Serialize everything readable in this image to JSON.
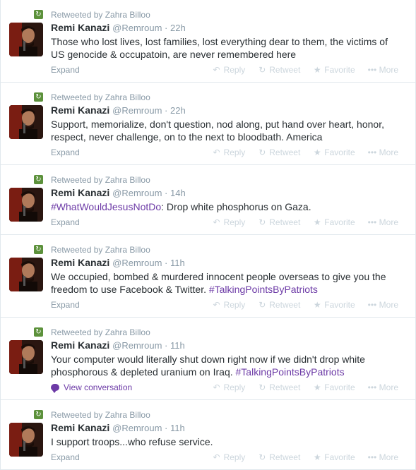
{
  "tweets": [
    {
      "retweeted_by": "Retweeted by Zahra Billoo",
      "fullname": "Remi Kanazi",
      "username": "@Remroum",
      "time": "22h",
      "text_parts": [
        {
          "t": "Those who lost lives, lost families, lost everything dear to them, the victims of US genocide & occupatoin, are never remembered here",
          "tag": false
        }
      ],
      "footer_link": "Expand",
      "footer_type": "expand"
    },
    {
      "retweeted_by": "Retweeted by Zahra Billoo",
      "fullname": "Remi Kanazi",
      "username": "@Remroum",
      "time": "22h",
      "text_parts": [
        {
          "t": "Support, memorialize, don't question, nod along, put hand over heart, honor, respect, never challenge, on to the next to bloodbath. America",
          "tag": false
        }
      ],
      "footer_link": "Expand",
      "footer_type": "expand"
    },
    {
      "retweeted_by": "Retweeted by Zahra Billoo",
      "fullname": "Remi Kanazi",
      "username": "@Remroum",
      "time": "14h",
      "text_parts": [
        {
          "t": "#WhatWouldJesusNotDo",
          "tag": true
        },
        {
          "t": ": Drop white phosphorus on Gaza.",
          "tag": false
        }
      ],
      "footer_link": "Expand",
      "footer_type": "expand"
    },
    {
      "retweeted_by": "Retweeted by Zahra Billoo",
      "fullname": "Remi Kanazi",
      "username": "@Remroum",
      "time": "11h",
      "text_parts": [
        {
          "t": "We occupied, bombed & murdered innocent people overseas to give you the freedom to use Facebook & Twitter. ",
          "tag": false
        },
        {
          "t": "#TalkingPointsByPatriots",
          "tag": true
        }
      ],
      "footer_link": "Expand",
      "footer_type": "expand"
    },
    {
      "retweeted_by": "Retweeted by Zahra Billoo",
      "fullname": "Remi Kanazi",
      "username": "@Remroum",
      "time": "11h",
      "text_parts": [
        {
          "t": "Your computer would literally shut down right now if we didn't drop white phosphorous & depleted uranium on Iraq. ",
          "tag": false
        },
        {
          "t": "#TalkingPointsByPatriots",
          "tag": true
        }
      ],
      "footer_link": "View conversation",
      "footer_type": "conversation"
    },
    {
      "retweeted_by": "Retweeted by Zahra Billoo",
      "fullname": "Remi Kanazi",
      "username": "@Remroum",
      "time": "11h",
      "text_parts": [
        {
          "t": "I support troops...who refuse service.",
          "tag": false
        }
      ],
      "footer_link": "Expand",
      "footer_type": "expand"
    }
  ],
  "actions": {
    "reply": "Reply",
    "retweet": "Retweet",
    "favorite": "Favorite",
    "more": "More"
  },
  "separator": "·",
  "colors": {
    "hashtag": "#6c3aa6",
    "retweet_badge": "#5c913b",
    "muted": "#8899a6",
    "action": "#ccd6dd"
  },
  "icons": {
    "retweet_badge": "retweet-icon",
    "reply": "reply-icon",
    "retweet": "retweet-icon",
    "favorite": "star-icon",
    "more": "more-dots-icon",
    "conversation": "speech-bubble-icon"
  }
}
